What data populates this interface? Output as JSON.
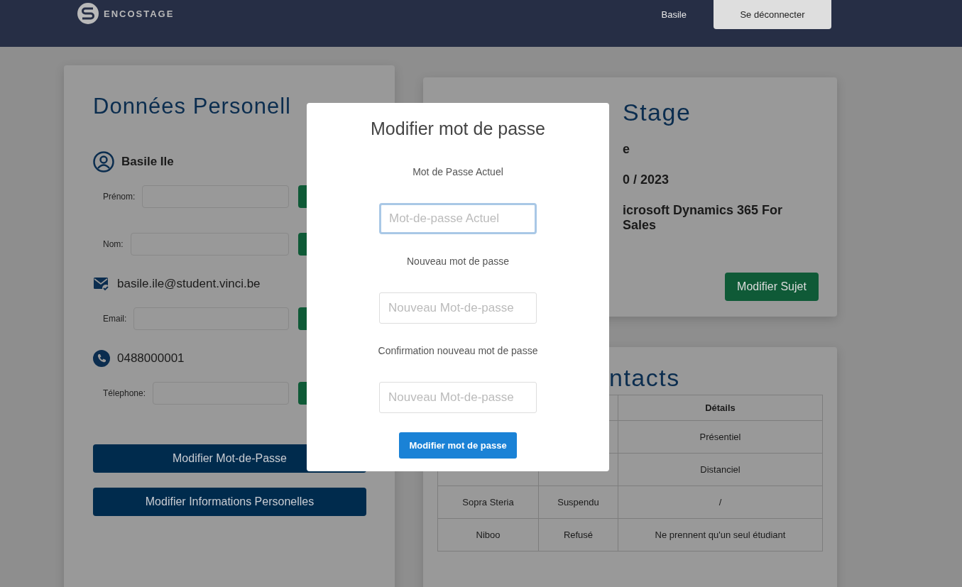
{
  "header": {
    "logo_text": "ENCOSTAGE",
    "user": "Basile",
    "logout": "Se déconnecter"
  },
  "personal_card": {
    "title": "Données Personell",
    "entries": [
      {
        "kind": "person",
        "text": "Basile Ile",
        "fields": [
          {
            "label": "Prénom:"
          },
          {
            "label": "Nom:"
          }
        ]
      },
      {
        "kind": "email",
        "text": "basile.ile@student.vinci.be",
        "fields": [
          {
            "label": "Email:"
          }
        ]
      },
      {
        "kind": "phone",
        "text": "0488000001",
        "fields": [
          {
            "label": "Télephone:"
          }
        ]
      }
    ],
    "buttons": [
      "Modifier Mot-de-Passe",
      "Modifier Informations Personelles"
    ]
  },
  "stage_card": {
    "title": "Stage",
    "lines": [
      "e",
      "0 / 2023",
      "icrosoft Dynamics 365 For Sales"
    ],
    "button": "Modifier Sujet"
  },
  "contacts_card": {
    "title": "ntacts",
    "header": {
      "column_3": "Détails"
    },
    "rows": [
      {
        "column_3": "Présentiel"
      },
      {
        "column_3": "Distanciel"
      },
      {
        "column_1": "Sopra Steria",
        "column_2": "Suspendu",
        "column_3": "/"
      },
      {
        "column_1": "Niboo",
        "column_2": "Refusé",
        "column_3": "Ne prennent qu'un seul étudiant"
      }
    ]
  },
  "modal": {
    "title": "Modifier mot de passe",
    "fields": [
      {
        "label": "Mot de Passe Actuel",
        "placeholder": "Mot-de-passe Actuel",
        "focused": true
      },
      {
        "label": "Nouveau mot de passe",
        "placeholder": "Nouveau Mot-de-passe",
        "focused": false
      },
      {
        "label": "Confirmation nouveau mot de passe",
        "placeholder": "Nouveau Mot-de-passe",
        "focused": false
      }
    ],
    "button": "Modifier mot de passe"
  }
}
